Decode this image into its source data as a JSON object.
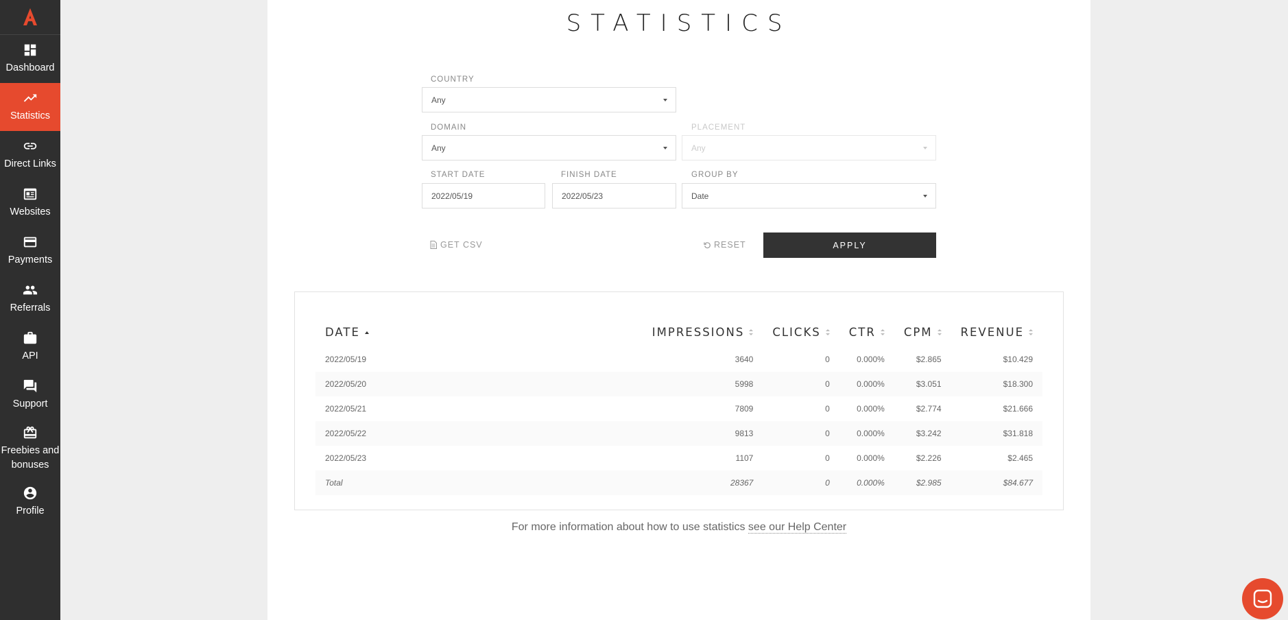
{
  "sidebar": {
    "items": [
      {
        "label": "Dashboard",
        "icon": "dashboard-icon"
      },
      {
        "label": "Statistics",
        "icon": "trending-up-icon",
        "active": true
      },
      {
        "label": "Direct Links",
        "icon": "link-icon"
      },
      {
        "label": "Websites",
        "icon": "websites-icon"
      },
      {
        "label": "Payments",
        "icon": "credit-card-icon"
      },
      {
        "label": "Referrals",
        "icon": "people-icon"
      },
      {
        "label": "API",
        "icon": "briefcase-icon"
      },
      {
        "label": "Support",
        "icon": "chat-icon"
      },
      {
        "label": "Freebies and bonuses",
        "icon": "gift-icon"
      },
      {
        "label": "Profile",
        "icon": "account-circle-icon"
      }
    ]
  },
  "page": {
    "title": "STATISTICS"
  },
  "filters": {
    "country": {
      "label": "COUNTRY",
      "value": "Any"
    },
    "domain": {
      "label": "DOMAIN",
      "value": "Any"
    },
    "placement": {
      "label": "PLACEMENT",
      "value": "Any",
      "disabled": true
    },
    "start_date": {
      "label": "START DATE",
      "value": "2022/05/19"
    },
    "finish_date": {
      "label": "FINISH DATE",
      "value": "2022/05/23"
    },
    "group_by": {
      "label": "GROUP BY",
      "value": "Date"
    }
  },
  "actions": {
    "csv": "GET CSV",
    "reset": "RESET",
    "apply": "APPLY"
  },
  "table": {
    "headers": {
      "date": "DATE",
      "impressions": "IMPRESSIONS",
      "clicks": "CLICKS",
      "ctr": "CTR",
      "cpm": "CPM",
      "revenue": "REVENUE"
    },
    "rows": [
      {
        "date": "2022/05/19",
        "impressions": "3640",
        "clicks": "0",
        "ctr": "0.000%",
        "cpm": "$2.865",
        "revenue": "$10.429"
      },
      {
        "date": "2022/05/20",
        "impressions": "5998",
        "clicks": "0",
        "ctr": "0.000%",
        "cpm": "$3.051",
        "revenue": "$18.300"
      },
      {
        "date": "2022/05/21",
        "impressions": "7809",
        "clicks": "0",
        "ctr": "0.000%",
        "cpm": "$2.774",
        "revenue": "$21.666"
      },
      {
        "date": "2022/05/22",
        "impressions": "9813",
        "clicks": "0",
        "ctr": "0.000%",
        "cpm": "$3.242",
        "revenue": "$31.818"
      },
      {
        "date": "2022/05/23",
        "impressions": "1107",
        "clicks": "0",
        "ctr": "0.000%",
        "cpm": "$2.226",
        "revenue": "$2.465"
      }
    ],
    "total": {
      "date": "Total",
      "impressions": "28367",
      "clicks": "0",
      "ctr": "0.000%",
      "cpm": "$2.985",
      "revenue": "$84.677"
    }
  },
  "help": {
    "text": "For more information about how to use statistics ",
    "link": "see our Help Center"
  },
  "colors": {
    "accent": "#e64a2e",
    "sidebar_bg": "#2f2f2f",
    "apply_bg": "#333333"
  }
}
